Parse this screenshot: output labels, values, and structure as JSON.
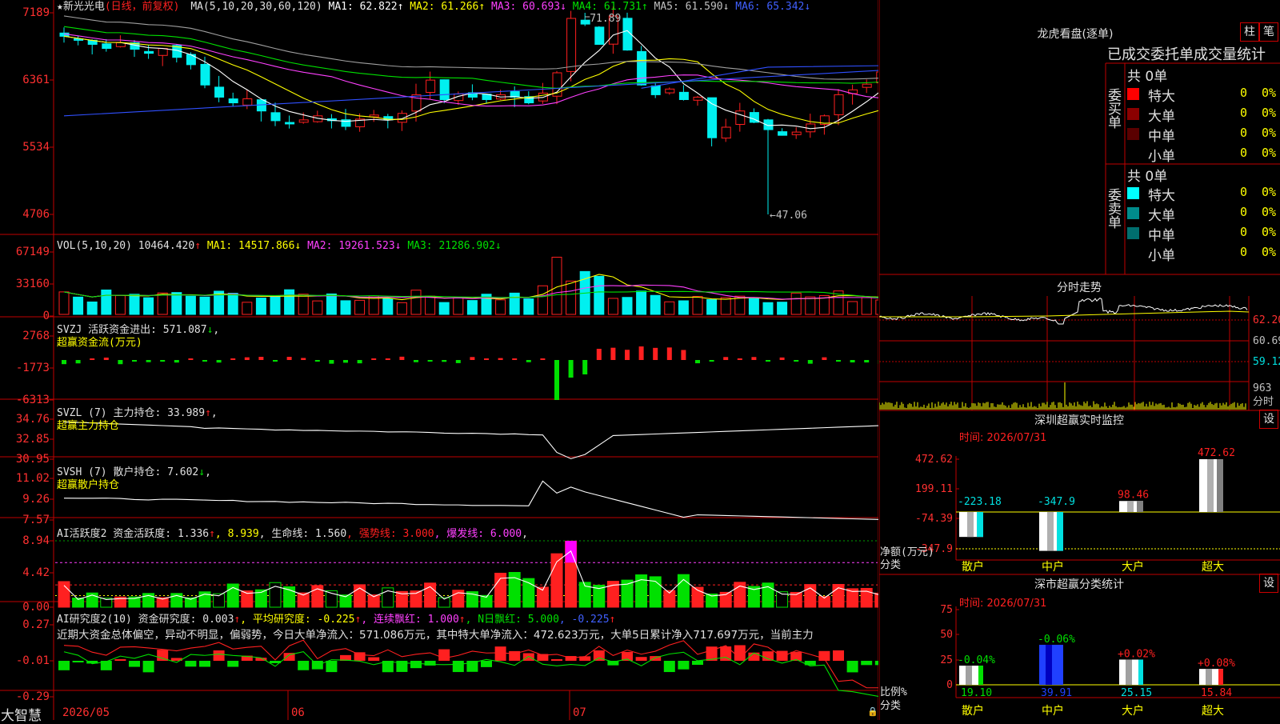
{
  "app": {
    "brand": "大智慧"
  },
  "stock": {
    "name": "★新光光电",
    "mode": "(日线，前复权)"
  },
  "colors": {
    "up": "#ff2020",
    "down": "#00f0f0",
    "red": "#ff2020",
    "green": "#00e000",
    "yellow": "#ffff00",
    "magenta": "#ff40ff",
    "blue": "#4060ff",
    "white": "#ffffff"
  },
  "price_panel": {
    "ma_label": "MA(5,10,20,30,60,120)",
    "ma": [
      {
        "label": "MA1: 62.822",
        "arrow": "↑",
        "color": "#ffffff"
      },
      {
        "label": "MA2: 61.266",
        "arrow": "↑",
        "color": "#ffff00"
      },
      {
        "label": "MA3: 60.693",
        "arrow": "↓",
        "color": "#ff40ff"
      },
      {
        "label": "MA4: 61.731",
        "arrow": "↑",
        "color": "#00e000"
      },
      {
        "label": "MA5: 61.590",
        "arrow": "↓",
        "color": "#c0c0c0"
      },
      {
        "label": "MA6: 65.342",
        "arrow": "↓",
        "color": "#4060ff"
      }
    ],
    "y_ticks": [
      "7189",
      "6361",
      "5534",
      "4706"
    ],
    "high_label": "71.89",
    "low_label": "←47.06"
  },
  "vol_panel": {
    "title": "VOL(5,10,20)",
    "value": "10464.420",
    "value_arrow": "↑",
    "ma": [
      {
        "label": "MA1: 14517.866",
        "arrow": "↓",
        "color": "#ffff00"
      },
      {
        "label": "MA2: 19261.523",
        "arrow": "↓",
        "color": "#ff40ff"
      },
      {
        "label": "MA3: 21286.902",
        "arrow": "↓",
        "color": "#00e000"
      }
    ],
    "y_ticks": [
      "67149",
      "33160",
      "0"
    ]
  },
  "svzj_panel": {
    "title": "SVZJ  活跃资金进出: 571.087",
    "arrow": "↓",
    "subtitle": "超赢资金流(万元)",
    "y_ticks": [
      "2768",
      "-1773",
      "-6313"
    ]
  },
  "svzl_panel": {
    "title": "SVZL (7) 主力持仓: 33.989",
    "arrow": "↑",
    "subtitle": "超赢主力持仓",
    "y_ticks": [
      "34.76",
      "32.85",
      "30.95"
    ]
  },
  "svsh_panel": {
    "title": "SVSH (7) 散户持仓: 7.602",
    "arrow": "↓",
    "subtitle": "超赢散户持仓",
    "y_ticks": [
      "11.02",
      "9.26",
      "7.57"
    ]
  },
  "ai1_panel": {
    "title": "AI活跃度2 资金活跃度: 1.336",
    "parts": [
      {
        "text": "↑",
        "color": "#ff2020"
      },
      {
        "text": ", 8.939",
        "color": "#ffff00"
      },
      {
        "text": ", 生命线: 1.560",
        "color": "#e0e0e0"
      },
      {
        "text": ", 强势线: 3.000",
        "color": "#ff2020"
      },
      {
        "text": ", 爆发线: 6.000",
        "color": "#ff40ff"
      },
      {
        "text": ",",
        "color": "#e0e0e0"
      }
    ],
    "y_ticks": [
      "8.94",
      "4.42",
      "0.00"
    ]
  },
  "ai2_panel": {
    "title": "AI研究度2(10) 资金研究度: 0.003",
    "parts": [
      {
        "text": "↑",
        "color": "#ff2020"
      },
      {
        "text": ", 平均研究度: -0.225",
        "color": "#ffff00"
      },
      {
        "text": "↑",
        "color": "#ff2020"
      },
      {
        "text": ", 连续飘红: 1.000",
        "color": "#ff40ff"
      },
      {
        "text": "↑",
        "color": "#ff2020"
      },
      {
        "text": ", N日飘红: 5.000",
        "color": "#00e000"
      },
      {
        "text": ", -0.225",
        "color": "#4060ff"
      },
      {
        "text": "↑",
        "color": "#ff2020"
      }
    ],
    "commentary": "近期大资金总体偏空，异动不明显，偏弱势，今日大单净流入：571.086万元，其中特大单净流入：472.623万元，大单5日累计净入717.697万元，当前主力",
    "y_ticks": [
      "0.27",
      "-0.01",
      "-0.29"
    ]
  },
  "x_axis": {
    "labels": [
      "2026/05",
      "06",
      "07"
    ]
  },
  "dragon": {
    "title": "龙虎看盘(逐单)",
    "btn_bar": "柱",
    "btn_pen": "笔",
    "header": "已成交委托单成交量统计",
    "buy": {
      "label": "委买单",
      "total": "共 0单",
      "rows": [
        {
          "name": "特大",
          "val": "0",
          "pct": "0%",
          "color": "#ff0000"
        },
        {
          "name": "大单",
          "val": "0",
          "pct": "0%",
          "color": "#8b0000"
        },
        {
          "name": "中单",
          "val": "0",
          "pct": "0%",
          "color": "#5a0000"
        },
        {
          "name": "小单",
          "val": "0",
          "pct": "0%",
          "color": "#000000"
        }
      ]
    },
    "sell": {
      "label": "委卖单",
      "total": "共 0单",
      "rows": [
        {
          "name": "特大",
          "val": "0",
          "pct": "0%",
          "color": "#00ffff"
        },
        {
          "name": "大单",
          "val": "0",
          "pct": "0%",
          "color": "#008b8b"
        },
        {
          "name": "中单",
          "val": "0",
          "pct": "0%",
          "color": "#006e6e"
        },
        {
          "name": "小单",
          "val": "0",
          "pct": "0%",
          "color": "#000000"
        }
      ]
    }
  },
  "intraday": {
    "title": "分时走势",
    "y_ticks": [
      "62.20",
      "60.69",
      "59.12"
    ],
    "vol_label": "963",
    "vol_unit": "分时"
  },
  "monitor": {
    "title": "深圳超赢实时监控",
    "btn": "设",
    "time": "时间: 2026/07/31",
    "y_ticks": [
      "472.62",
      "199.11",
      "-74.39",
      "-347.9"
    ],
    "ylabel": "净额(万元)",
    "xlabel": "分类",
    "categories": [
      "散户",
      "中户",
      "大户",
      "超大"
    ],
    "values": [
      -223.18,
      -347.9,
      98.46,
      472.62
    ],
    "value_labels": [
      "-223.18",
      "-347.9",
      "98.46",
      "472.62"
    ]
  },
  "classify": {
    "title": "深市超赢分类统计",
    "btn": "设",
    "time": "时间: 2026/07/31",
    "y_ticks": [
      "75",
      "50",
      "25",
      "0"
    ],
    "ylabel": "比例%",
    "xlabel": "分类",
    "categories": [
      "散户",
      "中户",
      "大户",
      "超大"
    ],
    "values": [
      19.1,
      39.91,
      25.15,
      15.84
    ],
    "value_labels": [
      "19.10",
      "39.91",
      "25.15",
      "15.84"
    ],
    "change_labels": [
      "-0.04%",
      "-0.06%",
      "+0.02%",
      "+0.08%"
    ]
  }
}
